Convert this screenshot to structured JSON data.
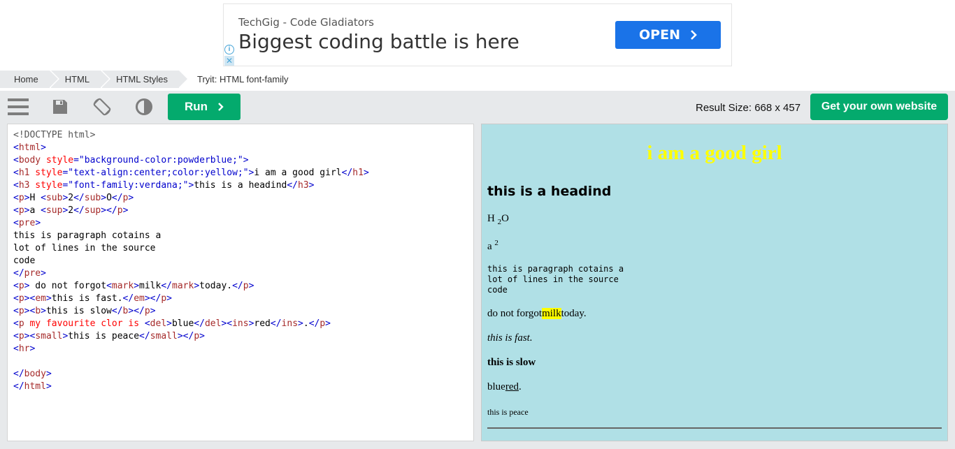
{
  "ad": {
    "subtitle": "TechGig - Code Gladiators",
    "title": "Biggest coding battle is here",
    "open_label": "OPEN",
    "info_glyph": "i",
    "close_glyph": "✕"
  },
  "breadcrumb": [
    {
      "label": "Home"
    },
    {
      "label": "HTML"
    },
    {
      "label": "HTML Styles"
    },
    {
      "label": "Tryit: HTML font-family"
    }
  ],
  "toolbar": {
    "icons": [
      "menu-icon",
      "save-icon",
      "rotate-icon",
      "contrast-icon"
    ],
    "run_label": "Run",
    "result_size": "Result Size: 668 x 457",
    "own_website_label": "Get your own website"
  },
  "result": {
    "h1": "i am a good girl",
    "h3": "this is a headind",
    "p_sub_a": "H ",
    "p_sub_b": "2",
    "p_sub_c": "O",
    "p_sup_a": "a ",
    "p_sup_b": "2",
    "pre": "this is paragraph cotains a\nlot of lines in the source\ncode",
    "p_mark_a": "do not forgot",
    "p_mark_b": "milk",
    "p_mark_c": "today.",
    "em": "this is fast.",
    "bold": "this is slow",
    "del_text": "blue",
    "ins_text": "red",
    "ins_after": ".",
    "small": "this is peace"
  },
  "colors": {
    "green": "#04aa6d",
    "toolbar_bg": "#e7e9eb",
    "result_bg": "powderblue",
    "h1_color": "yellow",
    "ad_button": "#1a73e8"
  }
}
